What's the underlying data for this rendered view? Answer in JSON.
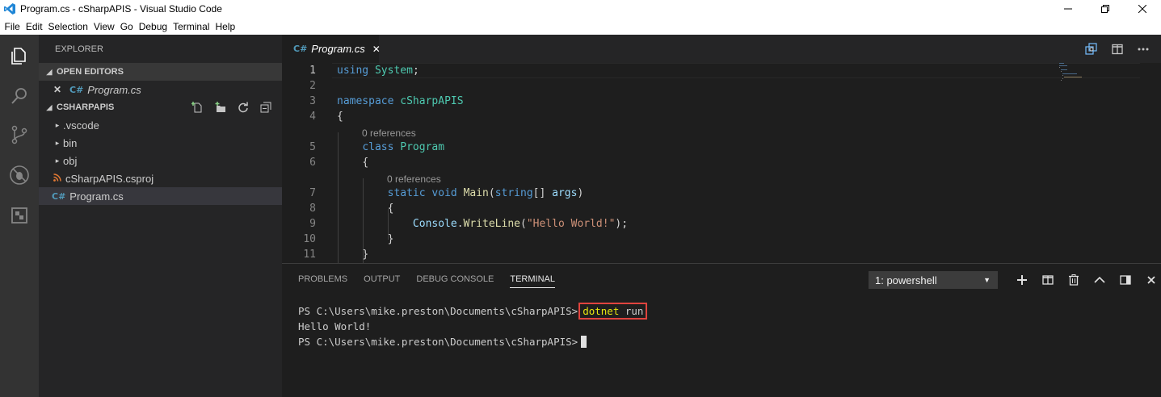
{
  "window": {
    "title": "Program.cs - cSharpAPIS - Visual Studio Code"
  },
  "menu": [
    "File",
    "Edit",
    "Selection",
    "View",
    "Go",
    "Debug",
    "Terminal",
    "Help"
  ],
  "sidebar": {
    "header": "EXPLORER",
    "open_editors": {
      "label": "OPEN EDITORS",
      "files": [
        {
          "close": "✕",
          "icon": "C#",
          "name": "Program.cs"
        }
      ]
    },
    "project": {
      "label": "CSHARPAPIS",
      "items": [
        {
          "name": ".vscode",
          "type": "folder"
        },
        {
          "name": "bin",
          "type": "folder"
        },
        {
          "name": "obj",
          "type": "folder"
        },
        {
          "name": "cSharpAPIS.csproj",
          "type": "csproj"
        },
        {
          "name": "Program.cs",
          "type": "cs",
          "selected": true
        }
      ]
    }
  },
  "editor": {
    "tab": {
      "label": "Program.cs",
      "close": "✕"
    },
    "lines": [
      {
        "n": "1",
        "code": "using System;"
      },
      {
        "n": "2",
        "code": ""
      },
      {
        "n": "3",
        "code": "namespace cSharpAPIS"
      },
      {
        "n": "4",
        "code": "{"
      },
      {
        "lens": "0 references"
      },
      {
        "n": "5",
        "code": "    class Program"
      },
      {
        "n": "6",
        "code": "    {"
      },
      {
        "lens": "0 references"
      },
      {
        "n": "7",
        "code": "        static void Main(string[] args)"
      },
      {
        "n": "8",
        "code": "        {"
      },
      {
        "n": "9",
        "code": "            Console.WriteLine(\"Hello World!\");"
      },
      {
        "n": "10",
        "code": "        }"
      },
      {
        "n": "11",
        "code": "    }"
      }
    ],
    "tokens": {
      "using": "using",
      "system": "System",
      "namespace": "namespace",
      "ns_name": "cSharpAPIS",
      "class": "class",
      "class_name": "Program",
      "static": "static",
      "void": "void",
      "main": "Main",
      "string": "string",
      "args": "args",
      "console": "Console",
      "writeline": "WriteLine",
      "hello": "\"Hello World!\"",
      "open_brace": "{",
      "close_brace": "}",
      "semicolon": ";",
      "lparen": "(",
      "rparen": ")",
      "brackets": "[]",
      "call_end": ");"
    }
  },
  "panel": {
    "tabs": [
      "PROBLEMS",
      "OUTPUT",
      "DEBUG CONSOLE",
      "TERMINAL"
    ],
    "active_tab": "TERMINAL",
    "terminal_select": "1: powershell",
    "terminal": {
      "prompt1": "PS C:\\Users\\mike.preston\\Documents\\cSharpAPIS>",
      "command_keyword": "dotnet",
      "command_args": " run",
      "output": "Hello World!",
      "prompt2": "PS C:\\Users\\mike.preston\\Documents\\cSharpAPIS>"
    }
  },
  "colors": {
    "highlight_box": "#e0443e",
    "activity_bar": "#333333",
    "sidebar": "#252526",
    "editor": "#1e1e1e"
  }
}
